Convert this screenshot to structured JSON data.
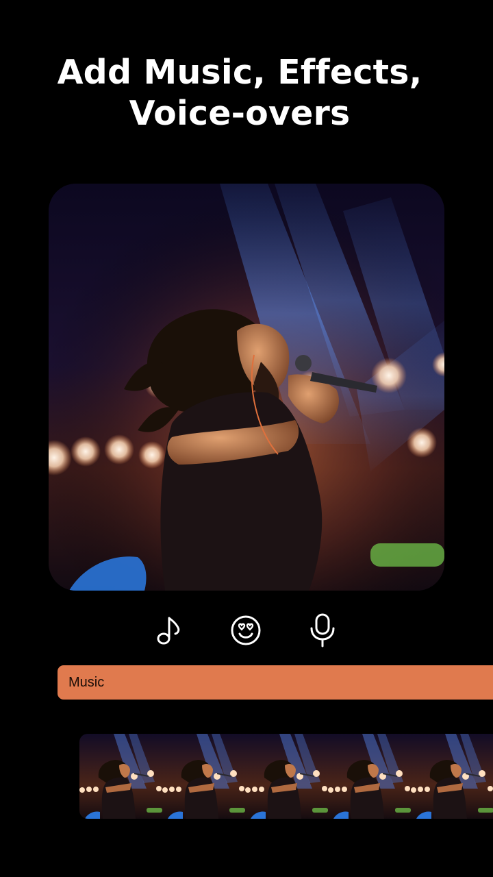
{
  "headline": {
    "line1": "Add Music, Effects,",
    "line2": "Voice-overs"
  },
  "preview": {
    "image": "concert-singer-photo"
  },
  "tools": [
    {
      "id": "music",
      "icon": "music-note-icon"
    },
    {
      "id": "effects",
      "icon": "heart-eyes-emoji-icon"
    },
    {
      "id": "voice",
      "icon": "microphone-icon"
    }
  ],
  "track": {
    "label": "Music",
    "color": "#e07a4e"
  },
  "filmstrip": {
    "frame_count": 5,
    "image": "concert-singer-thumbnail"
  },
  "colors": {
    "background": "#000000",
    "text": "#ffffff",
    "accent": "#e07a4e"
  }
}
